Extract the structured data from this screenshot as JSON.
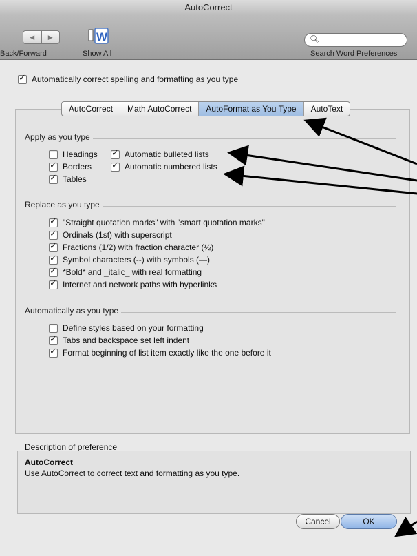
{
  "window": {
    "title": "AutoCorrect"
  },
  "toolbar": {
    "back_forward_label": "Back/Forward",
    "show_all_label": "Show All",
    "search_placeholder": "",
    "search_label": "Search Word Preferences"
  },
  "master_option": {
    "label": "Automatically correct spelling and formatting as you type",
    "checked": true
  },
  "tabs": [
    {
      "label": "AutoCorrect",
      "active": false
    },
    {
      "label": "Math AutoCorrect",
      "active": false
    },
    {
      "label": "AutoFormat as You Type",
      "active": true
    },
    {
      "label": "AutoText",
      "active": false
    }
  ],
  "apply_section": {
    "title": "Apply as you type",
    "items": [
      {
        "label": "Headings",
        "checked": false
      },
      {
        "label": "Borders",
        "checked": true
      },
      {
        "label": "Tables",
        "checked": true
      },
      {
        "label": "Automatic bulleted lists",
        "checked": true
      },
      {
        "label": "Automatic numbered lists",
        "checked": true
      }
    ]
  },
  "replace_section": {
    "title": "Replace as you type",
    "items": [
      {
        "label": "\"Straight quotation marks\" with \"smart quotation marks\"",
        "checked": true
      },
      {
        "label": "Ordinals (1st) with superscript",
        "checked": true
      },
      {
        "label": "Fractions (1/2) with fraction character (½)",
        "checked": true
      },
      {
        "label": "Symbol characters (--) with symbols (—)",
        "checked": true
      },
      {
        "label": "*Bold* and _italic_ with real formatting",
        "checked": true
      },
      {
        "label": "Internet and network paths with hyperlinks",
        "checked": true
      }
    ]
  },
  "auto_section": {
    "title": "Automatically as you type",
    "items": [
      {
        "label": "Define styles based on your formatting",
        "checked": false
      },
      {
        "label": "Tabs and backspace set left indent",
        "checked": true
      },
      {
        "label": "Format beginning of list item exactly like the one before it",
        "checked": true
      }
    ]
  },
  "description": {
    "label": "Description of preference",
    "title": "AutoCorrect",
    "text": "Use AutoCorrect to correct text and formatting as you type."
  },
  "buttons": {
    "cancel": "Cancel",
    "ok": "OK"
  },
  "colors": {
    "active_tab": "#9fbde2",
    "annotation_arrow": "#000000"
  }
}
